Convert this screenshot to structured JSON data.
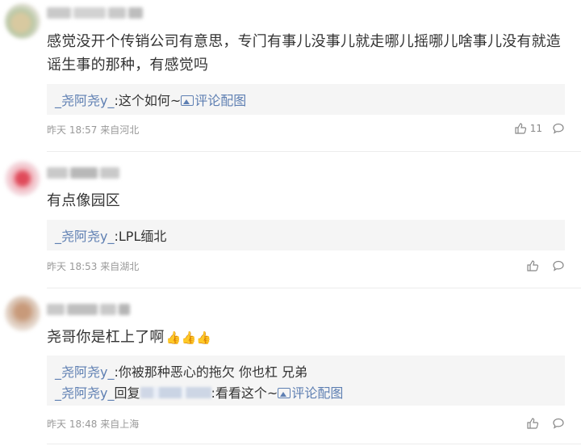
{
  "comments": [
    {
      "text": "感觉没开个传销公司有意思，专门有事儿没事儿就走哪儿摇哪儿啥事儿没有就造谣生事的那种，有感觉吗",
      "replies": [
        {
          "name": "_尧阿尧y_",
          "content": ":这个如何~",
          "pic_label": "评论配图"
        }
      ],
      "time": "昨天 18:57",
      "location": "来自河北",
      "likes": "11"
    },
    {
      "text": "有点像园区",
      "replies": [
        {
          "name": "_尧阿尧y_",
          "content": ":LPL缅北"
        }
      ],
      "time": "昨天 18:53",
      "location": "来自湖北",
      "likes": ""
    },
    {
      "text": "尧哥你是杠上了啊",
      "emoji": "👍👍👍",
      "replies": [
        {
          "name": "_尧阿尧y_",
          "content": ":你被那种恶心的拖欠 你也杠 兄弟"
        },
        {
          "name": "_尧阿尧y_",
          "reply_word": "回复",
          "content": ":看看这个~",
          "pic_label": "评论配图"
        }
      ],
      "time": "昨天 18:48",
      "location": "来自上海",
      "likes": ""
    }
  ],
  "colors": {
    "link": "#5e7fb2",
    "meta": "#999999",
    "reply_bg": "#f5f5f5"
  },
  "icons": {
    "like": "thumbs-up-icon",
    "comment": "speech-bubble-icon",
    "picture": "image-icon"
  }
}
